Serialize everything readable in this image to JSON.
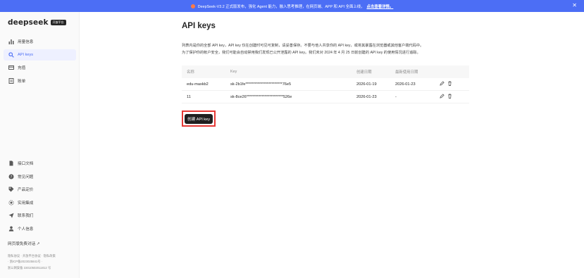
{
  "banner": {
    "icon": "megaphone-icon",
    "text": "DeepSeek-V3.2 正式版发布，强化 Agent 能力，融入思考推理，在网页端、APP 和 API 全面上线，",
    "link": "点击查看详情。",
    "close": "✕"
  },
  "brand": {
    "logo": "deepseek",
    "badge": "开放平台"
  },
  "sidebar": {
    "top_items": [
      {
        "label": "用量信息",
        "icon": "usage-chart-icon"
      },
      {
        "label": "API keys",
        "icon": "key-search-icon",
        "active": true
      },
      {
        "label": "充值",
        "icon": "wallet-icon"
      },
      {
        "label": "账单",
        "icon": "bill-icon"
      }
    ],
    "bottom_items": [
      {
        "label": "接口文档",
        "icon": "doc-icon"
      },
      {
        "label": "常见问题",
        "icon": "question-icon"
      },
      {
        "label": "产品定价",
        "icon": "tag-icon"
      },
      {
        "label": "实用集成",
        "icon": "integration-icon"
      },
      {
        "label": "联系我们",
        "icon": "send-icon"
      },
      {
        "label": "个人信息",
        "icon": "user-icon"
      }
    ],
    "free_chat": "网页版免费对话 ↗",
    "footer": [
      "隐私协议 · 开放平台协议 · 隐私政策",
      "· 浙ICP备2023025841号 ·",
      "浙公网安备 33010502011812 号"
    ]
  },
  "main": {
    "title": "API keys",
    "description": [
      "列表内是你的全部 API key，API key 仅在创建时可见可复制，请妥善保存。不要与他人共享你的 API key，或将其暴露在浏览器或其他客户端代码中。",
      "为了保护你的帐户安全，我们可能会自动禁用我们发现已公开泄露的 API key。我们未对 2024 年 4 月 25 日前创建的 API key 的使用情况进行追踪。"
    ],
    "table": {
      "headers": [
        "名称",
        "Key",
        "创建日期",
        "最新使用日期",
        ""
      ],
      "rows": [
        [
          "edu-maxkb2",
          "sk-2b1fe************************76e5",
          "2026-01-19",
          "2026-01-23"
        ],
        [
          "11",
          "sk-8ce26************************526e",
          "2026-01-23",
          "-"
        ]
      ]
    },
    "create_button": "创建 API key"
  },
  "colors": {
    "accent": "#4c6ef5",
    "highlight_border": "#e53935"
  }
}
